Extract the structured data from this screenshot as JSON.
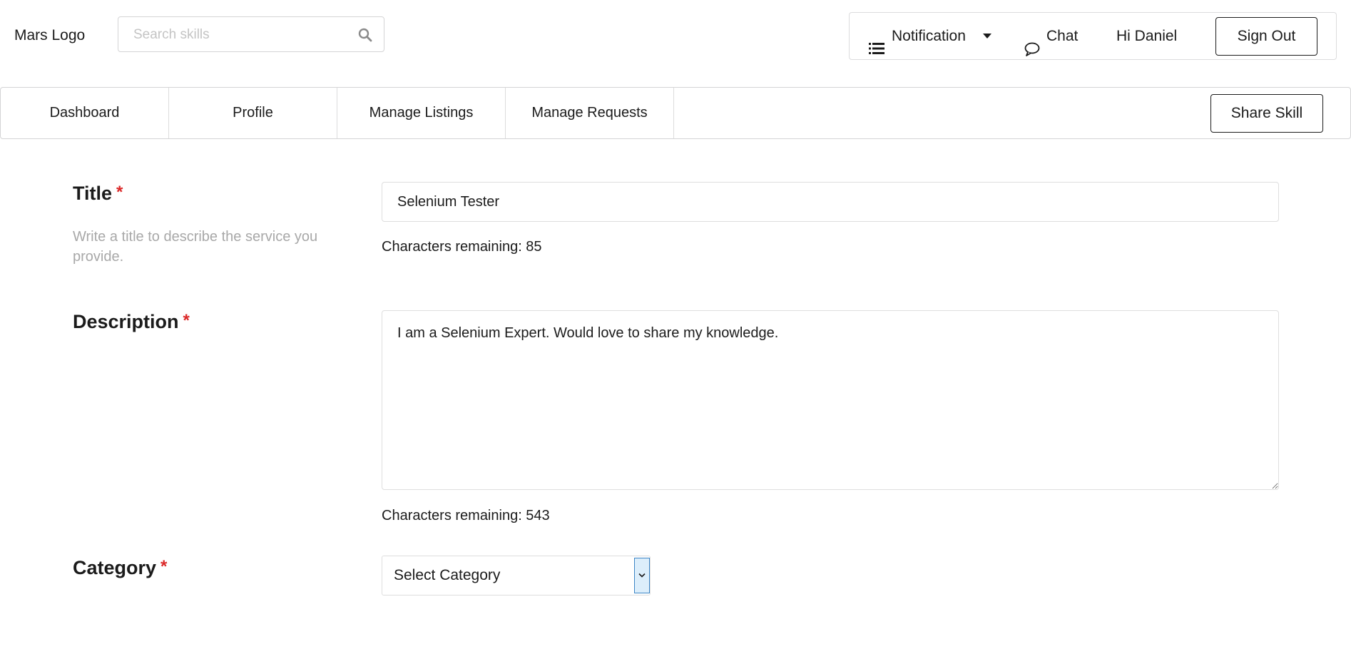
{
  "header": {
    "logo": "Mars Logo",
    "search_placeholder": "Search skills",
    "notification_label": "Notification",
    "chat_label": "Chat",
    "greeting": "Hi Daniel",
    "signout_label": "Sign Out"
  },
  "nav": {
    "tabs": [
      {
        "label": "Dashboard"
      },
      {
        "label": "Profile"
      },
      {
        "label": "Manage Listings"
      },
      {
        "label": "Manage Requests"
      }
    ],
    "share_label": "Share Skill"
  },
  "form": {
    "required_mark": "*",
    "title": {
      "label": "Title",
      "helper": "Write a title to describe the service you provide.",
      "value": "Selenium Tester",
      "remaining": "Characters remaining: 85"
    },
    "description": {
      "label": "Description",
      "value": "I am a Selenium Expert. Would love to share my knowledge.",
      "remaining": "Characters remaining: 543"
    },
    "category": {
      "label": "Category",
      "selected": "Select Category"
    }
  },
  "colors": {
    "required": "#db2828",
    "helper_text": "#a8a8a8",
    "select_arrow_bg": "#dceefb",
    "select_arrow_border": "#3c86c6"
  },
  "icons": [
    "search-icon",
    "list-icon",
    "caret-down-icon",
    "chat-icon",
    "chevron-down-icon"
  ]
}
